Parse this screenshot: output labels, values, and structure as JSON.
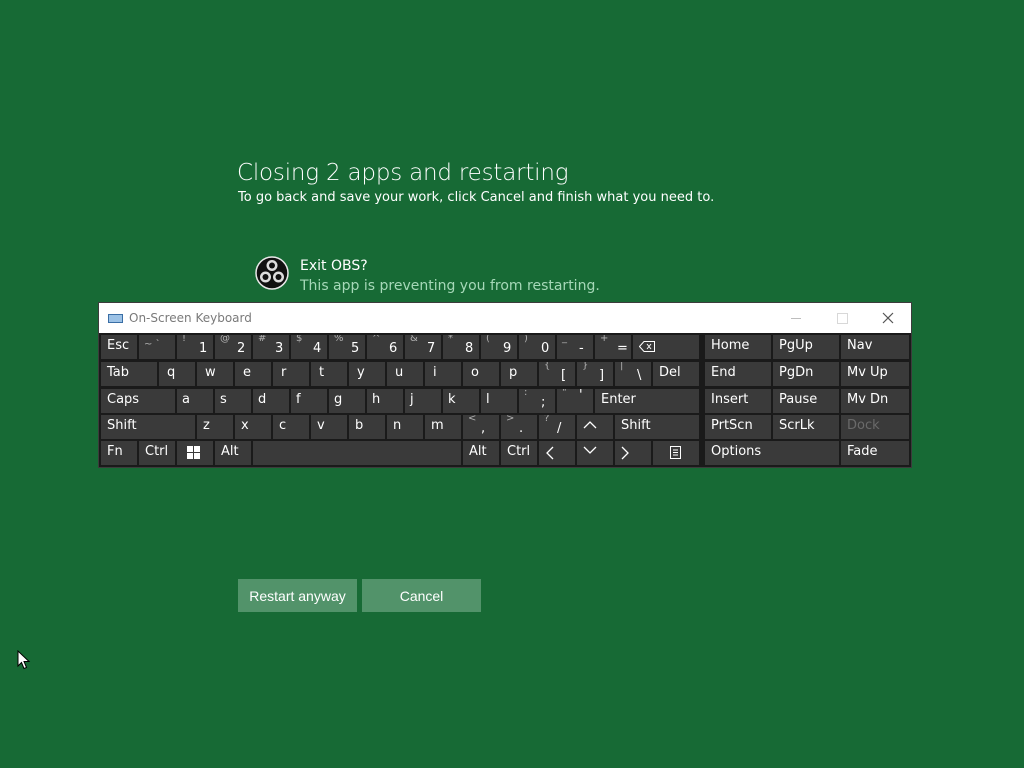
{
  "dialog": {
    "title": "Closing 2 apps and restarting",
    "subtitle": "To go back and save your work, click Cancel and finish what you need to.",
    "app": {
      "name": "Exit OBS?",
      "description": "This app is preventing you from restarting.",
      "icon": "obs-icon"
    },
    "buttons": {
      "restart": "Restart anyway",
      "cancel": "Cancel"
    }
  },
  "osk": {
    "title": "On-Screen Keyboard",
    "keys": {
      "esc": "Esc",
      "tilde_s": "~ `",
      "k1_s": "!",
      "k1": "1",
      "k2_s": "@",
      "k2": "2",
      "k3_s": "#",
      "k3": "3",
      "k4_s": "$",
      "k4": "4",
      "k5_s": "%",
      "k5": "5",
      "k6_s": "^",
      "k6": "6",
      "k7_s": "&",
      "k7": "7",
      "k8_s": "*",
      "k8": "8",
      "k9_s": "(",
      "k9": "9",
      "k0_s": ")",
      "k0": "0",
      "minus_s": "_",
      "minus": "-",
      "plus_s": "+",
      "plus": "=",
      "tab": "Tab",
      "q": "q",
      "w": "w",
      "e": "e",
      "r": "r",
      "t": "t",
      "y": "y",
      "u": "u",
      "i": "i",
      "o": "o",
      "p": "p",
      "lbr_s": "{",
      "lbr": "[",
      "rbr_s": "}",
      "rbr": "]",
      "bs_s": "|",
      "bs": "\\",
      "del": "Del",
      "caps": "Caps",
      "a": "a",
      "s": "s",
      "d": "d",
      "f": "f",
      "g": "g",
      "h": "h",
      "j": "j",
      "k": "k",
      "l": "l",
      "semi_s": ":",
      "semi": ";",
      "quote_s": "\"",
      "quote": "'",
      "enter": "Enter",
      "shift": "Shift",
      "z": "z",
      "x": "x",
      "c": "c",
      "v": "v",
      "b": "b",
      "n": "n",
      "m": "m",
      "comma_s": "<",
      "comma": ",",
      "period_s": ">",
      "period": ".",
      "slash_s": "?",
      "slash": "/",
      "rshift": "Shift",
      "fn": "Fn",
      "ctrl": "Ctrl",
      "alt": "Alt",
      "ralt": "Alt",
      "rctrl": "Ctrl",
      "home": "Home",
      "pgup": "PgUp",
      "nav": "Nav",
      "end": "End",
      "pgdn": "PgDn",
      "mvup": "Mv Up",
      "insert": "Insert",
      "pause": "Pause",
      "mvdn": "Mv Dn",
      "prtscn": "PrtScn",
      "scrlk": "ScrLk",
      "dock": "Dock",
      "options": "Options",
      "fade": "Fade"
    }
  }
}
